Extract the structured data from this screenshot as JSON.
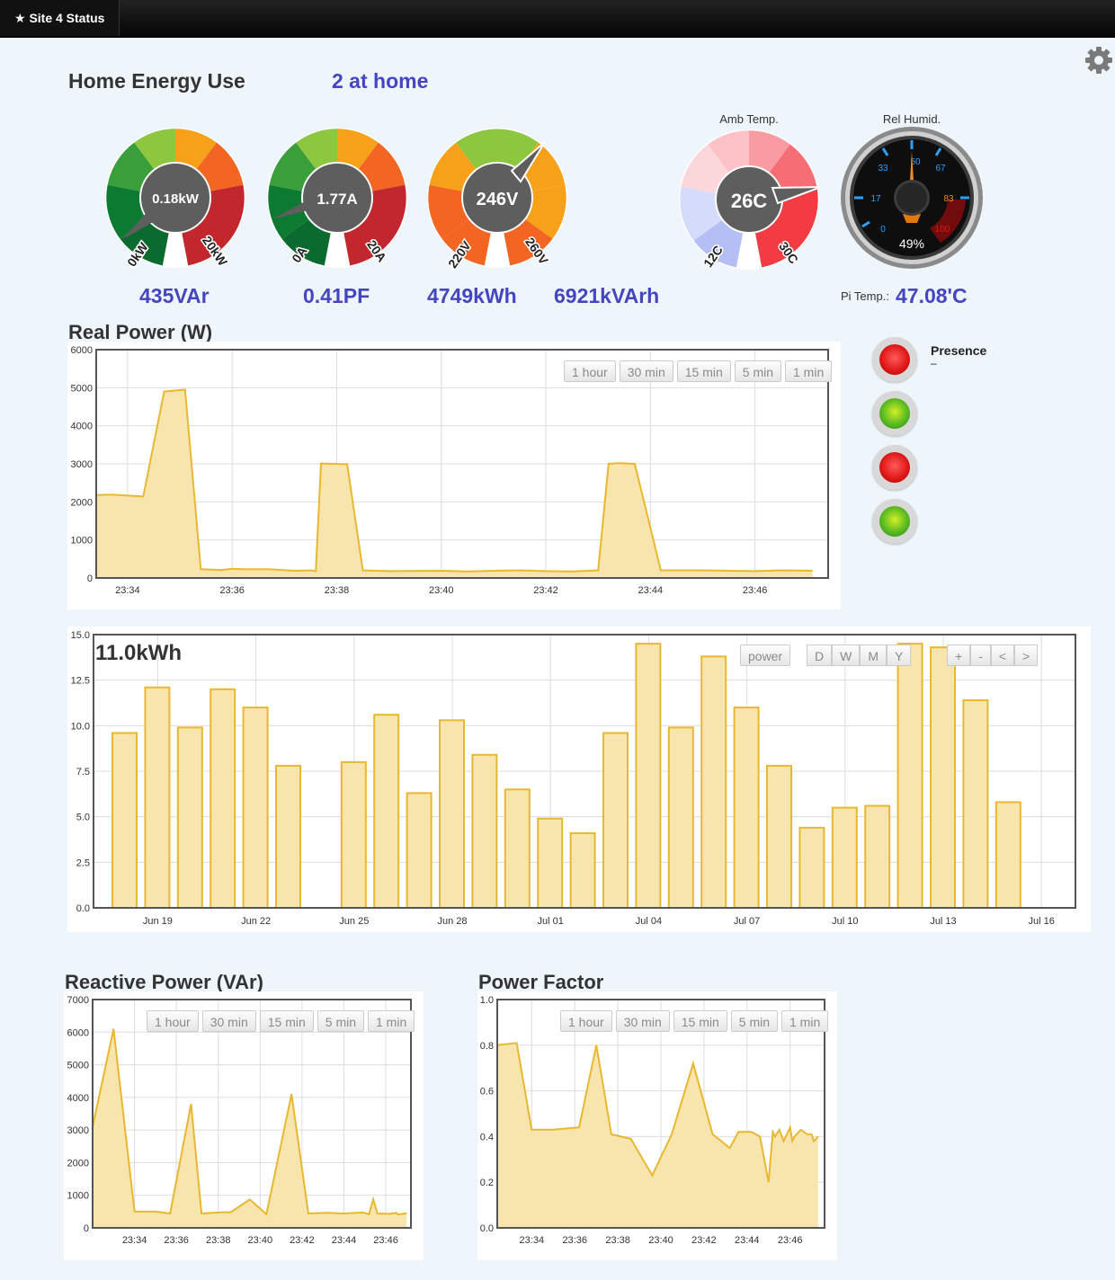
{
  "nav": {
    "brand": "★ Site 4 Status"
  },
  "header": {
    "title": "Home Energy Use",
    "presence_count": "2 at home"
  },
  "gauges": {
    "power": {
      "value": "0.18kW",
      "min": "0kW",
      "max": "20kW"
    },
    "current": {
      "value": "1.77A",
      "min": "0A",
      "max": "20A"
    },
    "voltage": {
      "value": "246V",
      "min": "220V",
      "max": "260V"
    },
    "temp": {
      "label": "Amb Temp.",
      "value": "26C",
      "min": "12C",
      "max": "30C"
    },
    "humid": {
      "label": "Rel Humid.",
      "value": "49%",
      "ticks": [
        "0",
        "17",
        "33",
        "50",
        "67",
        "83",
        "100"
      ]
    }
  },
  "stats": {
    "reactive": "435VAr",
    "pf": "0.41PF",
    "energy": "4749kWh",
    "reactive_energy": "6921kVArh",
    "pi_temp_label": "Pi Temp.:",
    "pi_temp_value": "47.08'C"
  },
  "sections": {
    "real_power": "Real Power (W)",
    "reactive_power": "Reactive Power (VAr)",
    "power_factor": "Power Factor"
  },
  "range_buttons": [
    "1 hour",
    "30 min",
    "15 min",
    "5 min",
    "1 min"
  ],
  "energy_buttons": {
    "mode": "power",
    "periods": [
      "D",
      "W",
      "M",
      "Y"
    ],
    "nav": [
      "+",
      "-",
      "<",
      ">"
    ]
  },
  "presence": {
    "label": "Presence",
    "value": "–",
    "lights": [
      "red",
      "green",
      "red",
      "green"
    ]
  },
  "colors": {
    "accent": "#4545c0",
    "series_line": "#e8b830",
    "series_fill": "#f8e4ad"
  },
  "chart_data": [
    {
      "id": "real_power",
      "type": "area",
      "title": "Real Power (W)",
      "ylim": [
        0,
        6000
      ],
      "yticks": [
        0,
        1000,
        2000,
        3000,
        4000,
        5000,
        6000
      ],
      "xlim": [
        33.4,
        47.4
      ],
      "xticks": [
        "23:34",
        "23:36",
        "23:38",
        "23:40",
        "23:42",
        "23:44",
        "23:46"
      ],
      "x": [
        33.4,
        33.7,
        34.1,
        34.3,
        34.7,
        35.1,
        35.4,
        35.8,
        36.0,
        36.2,
        36.7,
        37.2,
        37.5,
        37.6,
        37.7,
        38.2,
        38.5,
        39.0,
        40.0,
        40.5,
        41.0,
        41.5,
        42.0,
        42.5,
        42.8,
        43.0,
        43.2,
        43.4,
        43.7,
        44.2,
        45.0,
        46.0,
        46.5,
        47.1
      ],
      "y": [
        2180,
        2190,
        2160,
        2140,
        4900,
        4950,
        230,
        210,
        240,
        230,
        230,
        190,
        200,
        180,
        3010,
        2990,
        200,
        180,
        190,
        170,
        190,
        200,
        180,
        170,
        190,
        200,
        3000,
        3020,
        3000,
        200,
        200,
        180,
        200,
        190
      ]
    },
    {
      "id": "energy",
      "type": "bar",
      "title": "11.0kWh",
      "ylim": [
        0,
        15
      ],
      "yticks": [
        "0.0",
        "2.5",
        "5.0",
        "7.5",
        "10.0",
        "12.5",
        "15.0"
      ],
      "xticks": [
        "Jun 19",
        "Jun 22",
        "Jun 25",
        "Jun 28",
        "Jul 01",
        "Jul 04",
        "Jul 07",
        "Jul 10",
        "Jul 13",
        "Jul 16"
      ],
      "categories": [
        "Jun 18",
        "Jun 19",
        "Jun 20",
        "Jun 21",
        "Jun 22",
        "Jun 23",
        "Jun 24",
        "Jun 25",
        "Jun 26",
        "Jun 27",
        "Jun 28",
        "Jun 29",
        "Jun 30",
        "Jul 01",
        "Jul 02",
        "Jul 03",
        "Jul 04",
        "Jul 05",
        "Jul 06",
        "Jul 07",
        "Jul 08",
        "Jul 09",
        "Jul 10",
        "Jul 11",
        "Jul 12",
        "Jul 13",
        "Jul 14",
        "Jul 15"
      ],
      "values": [
        9.6,
        12.1,
        9.9,
        12.0,
        11.0,
        7.8,
        null,
        8.0,
        10.6,
        6.3,
        10.3,
        8.4,
        6.5,
        4.9,
        4.1,
        9.6,
        14.5,
        9.9,
        13.8,
        11.0,
        7.8,
        4.4,
        5.5,
        5.6,
        14.5,
        14.3,
        11.4,
        5.8
      ]
    },
    {
      "id": "reactive_power",
      "type": "area",
      "title": "Reactive Power (VAr)",
      "ylim": [
        0,
        7000
      ],
      "yticks": [
        0,
        1000,
        2000,
        3000,
        4000,
        5000,
        6000,
        7000
      ],
      "xlim": [
        32.0,
        47.2
      ],
      "xticks": [
        "23:34",
        "23:36",
        "23:38",
        "23:40",
        "23:42",
        "23:44",
        "23:46"
      ],
      "x": [
        32.0,
        33.0,
        34.0,
        35.0,
        35.7,
        36.7,
        37.2,
        38.2,
        38.6,
        39.5,
        40.3,
        41.5,
        42.3,
        43.2,
        44.0,
        44.9,
        45.2,
        45.4,
        45.6,
        46.2,
        46.5,
        46.6,
        47.0
      ],
      "y": [
        3100,
        6100,
        500,
        500,
        440,
        3800,
        440,
        480,
        480,
        870,
        420,
        4100,
        440,
        460,
        440,
        470,
        420,
        880,
        440,
        430,
        460,
        410,
        450
      ]
    },
    {
      "id": "power_factor",
      "type": "area",
      "title": "Power Factor",
      "ylim": [
        0,
        1.0
      ],
      "yticks": [
        "0.0",
        "0.2",
        "0.4",
        "0.6",
        "0.8",
        "1.0"
      ],
      "xlim": [
        32.4,
        47.6
      ],
      "xticks": [
        "23:34",
        "23:36",
        "23:38",
        "23:40",
        "23:42",
        "23:44",
        "23:46"
      ],
      "x": [
        32.4,
        33.3,
        34.0,
        35.0,
        36.2,
        37.0,
        37.7,
        38.6,
        39.6,
        40.5,
        41.5,
        42.4,
        43.2,
        43.6,
        44.2,
        44.6,
        45.0,
        45.2,
        45.3,
        45.5,
        45.7,
        46.0,
        46.1,
        46.2,
        46.5,
        46.8,
        47.0,
        47.1,
        47.3
      ],
      "y": [
        0.8,
        0.81,
        0.43,
        0.43,
        0.44,
        0.8,
        0.41,
        0.39,
        0.23,
        0.41,
        0.72,
        0.41,
        0.35,
        0.42,
        0.42,
        0.4,
        0.2,
        0.42,
        0.4,
        0.43,
        0.38,
        0.44,
        0.38,
        0.4,
        0.43,
        0.41,
        0.41,
        0.38,
        0.4
      ]
    }
  ]
}
